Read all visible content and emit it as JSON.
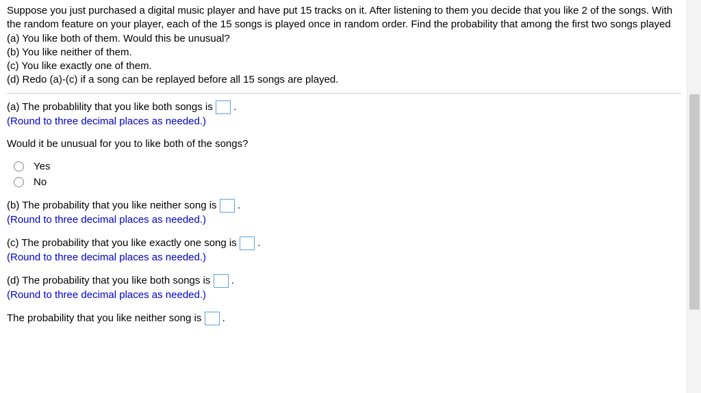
{
  "prompt": {
    "intro": "Suppose you just purchased a digital music player and have put 15 tracks on it. After listening to them you decide that you like 2 of the songs. With the random feature on your player, each of the 15 songs is played once in random order. Find the probability that among the first two songs played",
    "a": "(a) You like both of them. Would this be unusual?",
    "b": "(b) You like neither of them.",
    "c": "(c) You like exactly one of them.",
    "d": "(d) Redo (a)-(c) if a song can be replayed before all 15 songs are played."
  },
  "partA": {
    "label_before": "(a) The probablility that you like both songs is ",
    "label_after": ".",
    "hint": "(Round to three decimal places as needed.)",
    "question": "Would it be unusual for you to like both of the songs?",
    "options": {
      "yes": "Yes",
      "no": "No"
    }
  },
  "partB": {
    "label_before": "(b) The probability that you like neither song is ",
    "label_after": ".",
    "hint": "(Round to three decimal places as needed.)"
  },
  "partC": {
    "label_before": "(c) The probability that you like exactly one song is ",
    "label_after": ".",
    "hint": "(Round to three decimal places as needed.)"
  },
  "partD": {
    "label_before": "(d) The probability that you like both songs is ",
    "label_after": ".",
    "hint": "(Round to three decimal places as needed.)",
    "line2_before": "The probability that you like neither song  is ",
    "line2_after": "."
  }
}
